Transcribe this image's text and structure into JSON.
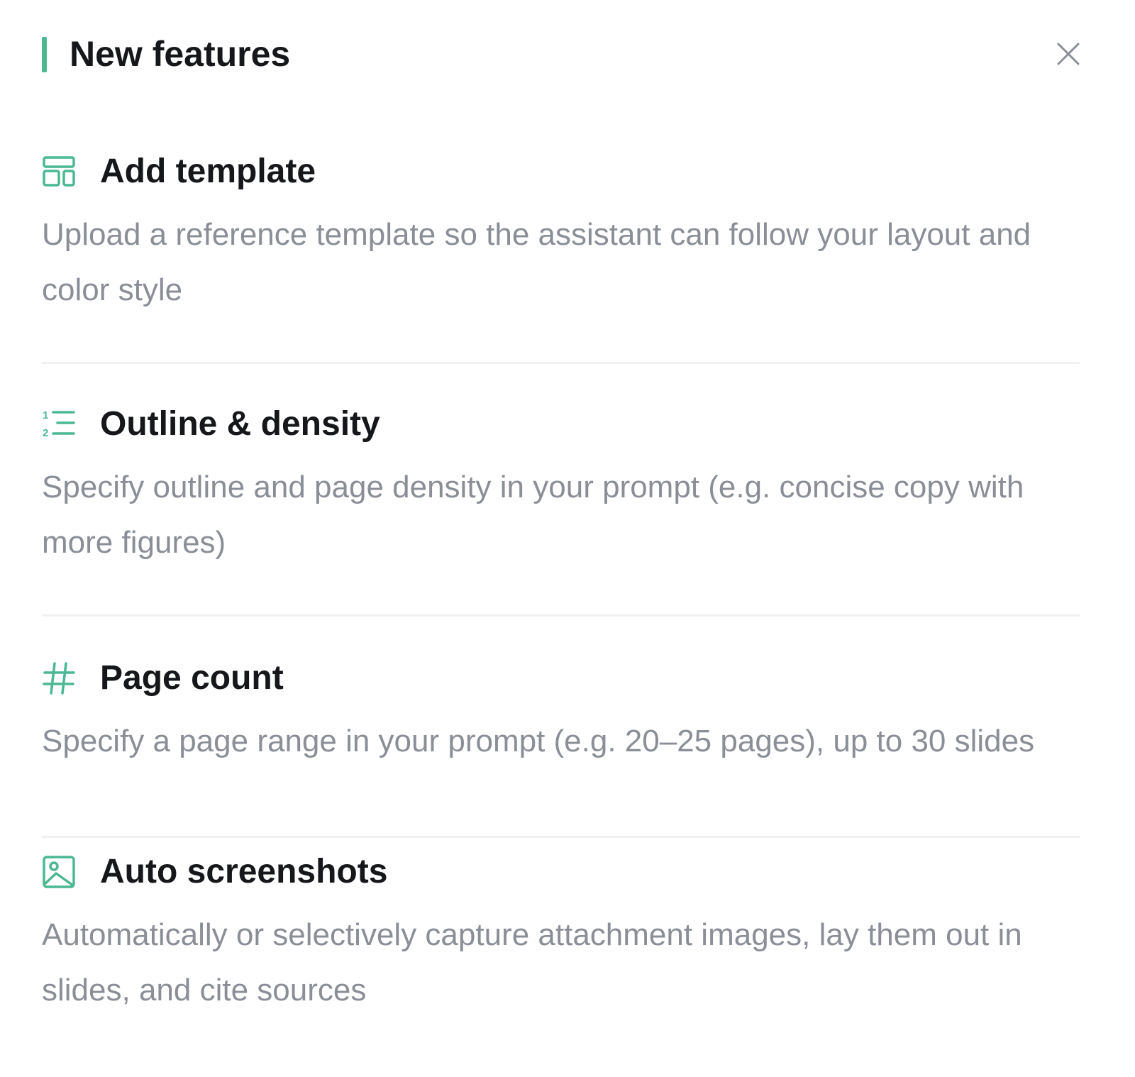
{
  "panel": {
    "title": "New features",
    "accent_color": "#4cb892",
    "close_icon": "close-icon"
  },
  "features": [
    {
      "icon": "template-icon",
      "title": "Add template",
      "description": "Upload a reference template so the assistant can follow your layout and color style"
    },
    {
      "icon": "numbered-list-icon",
      "title": "Outline & density",
      "description": "Specify outline and page density in your prompt (e.g. concise copy with more figures)"
    },
    {
      "icon": "hash-icon",
      "title": "Page count",
      "description": "Specify a page range in your prompt (e.g. 20–25 pages), up to 30 slides"
    },
    {
      "icon": "image-icon",
      "title": "Auto screenshots",
      "description": "Automatically or selectively capture attachment images, lay them out in slides, and cite sources"
    }
  ]
}
